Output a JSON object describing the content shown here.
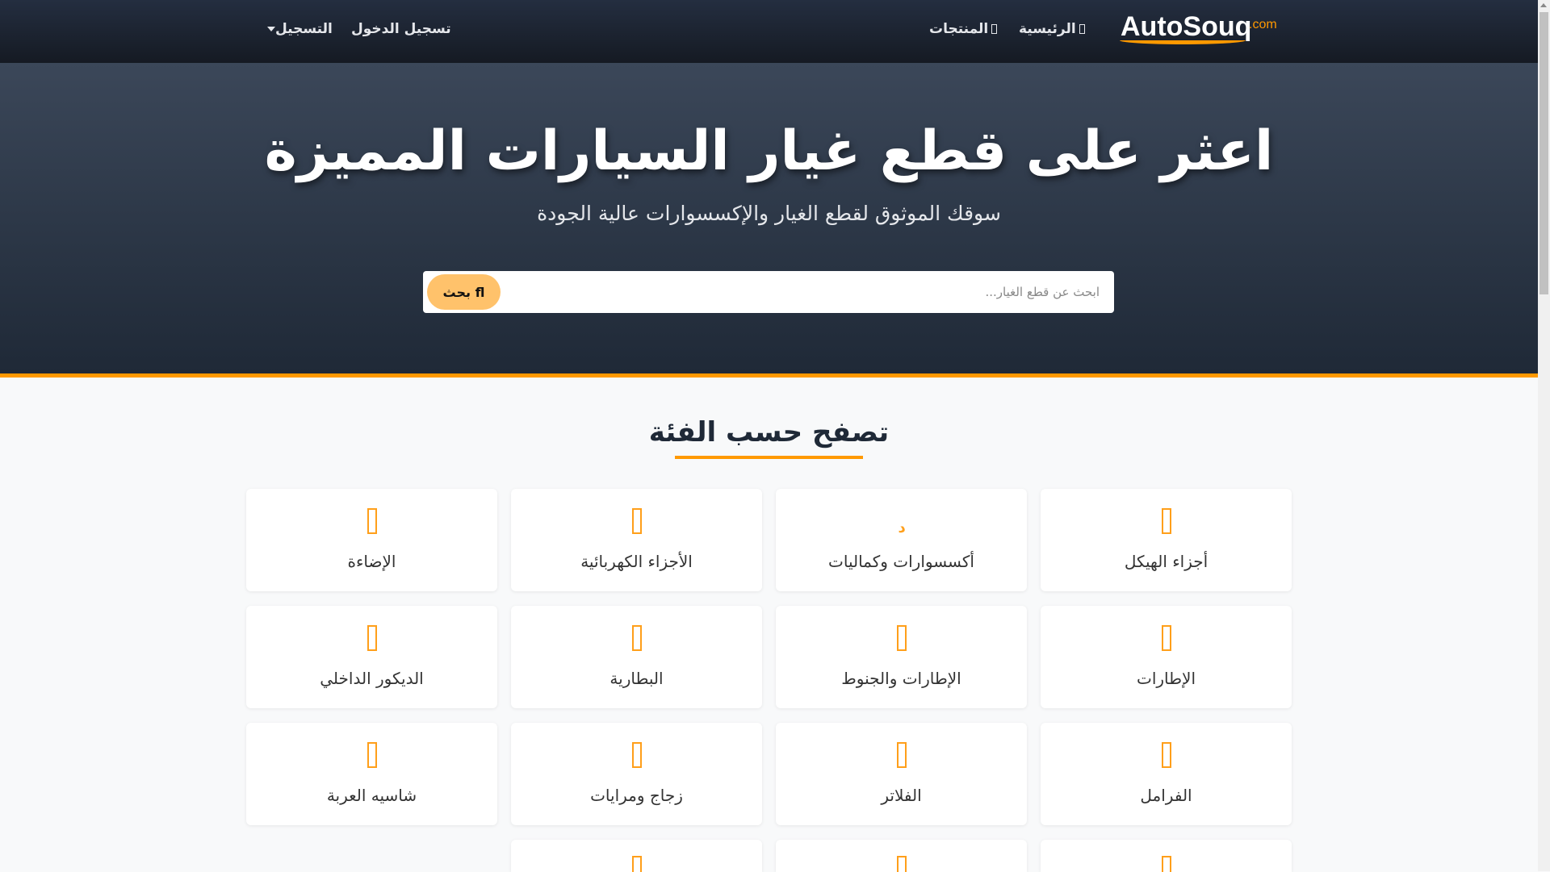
{
  "nav": {
    "logo": "AutoSouq",
    "logo_suffix": ".com",
    "home": "الرئيسية",
    "products": "المنتجات",
    "login": "تسجيل الدخول",
    "register": "التسجيل"
  },
  "hero": {
    "title": "اعثر على قطع غيار السيارات المميزة",
    "subtitle": "سوقك الموثوق لقطع الغيار والإكسسوارات عالية الجودة",
    "search_placeholder": "ابحث عن قطع الغيار...",
    "search_button": "ﬂ بحث"
  },
  "categories": {
    "title": "تصفح حسب الفئة",
    "items": [
      {
        "label": "أجزاء الهيكل",
        "icon": "category-icon"
      },
      {
        "label": "أكسسوارات وكماليات",
        "icon": "accessories-icon"
      },
      {
        "label": "الأجزاء الكهربائية",
        "icon": "category-icon"
      },
      {
        "label": "الإضاءة",
        "icon": "category-icon"
      },
      {
        "label": "الإطارات",
        "icon": "category-icon"
      },
      {
        "label": "الإطارات والجنوط",
        "icon": "category-icon"
      },
      {
        "label": "البطارية",
        "icon": "category-icon"
      },
      {
        "label": "الديكور الداخلي",
        "icon": "category-icon"
      },
      {
        "label": "الفرامل",
        "icon": "category-icon"
      },
      {
        "label": "الفلاتر",
        "icon": "category-icon"
      },
      {
        "label": "زجاج ومرايات",
        "icon": "category-icon"
      },
      {
        "label": "شاسيه العربة",
        "icon": "category-icon"
      },
      {
        "label": "",
        "icon": "category-icon"
      },
      {
        "label": "",
        "icon": "category-icon"
      },
      {
        "label": "",
        "icon": "category-icon"
      }
    ]
  },
  "colors": {
    "accent": "#ff9900",
    "nav_bg": "#1f2937",
    "button": "#ffc26b"
  }
}
